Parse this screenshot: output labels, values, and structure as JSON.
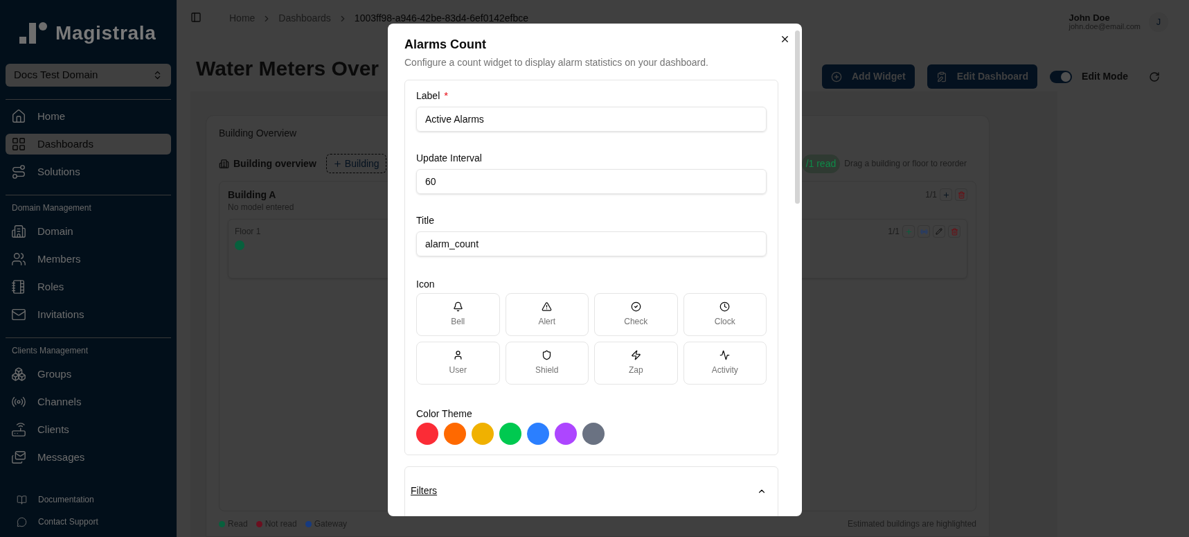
{
  "sidebar": {
    "logo": "Magistrala",
    "domain_select": "Docs Test Domain",
    "sections": [
      {
        "items": [
          {
            "label": "Home",
            "selected": false
          },
          {
            "label": "Dashboards",
            "selected": true
          },
          {
            "label": "Solutions",
            "selected": false
          }
        ]
      },
      {
        "heading": "Domain Management",
        "items": [
          {
            "label": "Domain",
            "selected": false
          },
          {
            "label": "Members",
            "selected": false
          },
          {
            "label": "Roles",
            "selected": false
          },
          {
            "label": "Invitations",
            "selected": false
          }
        ]
      },
      {
        "heading": "Clients Management",
        "items": [
          {
            "label": "Groups",
            "selected": false
          },
          {
            "label": "Channels",
            "selected": false
          },
          {
            "label": "Clients",
            "selected": false
          },
          {
            "label": "Messages",
            "selected": false
          }
        ]
      }
    ],
    "footer_links": [
      "Documentation",
      "Contact Support"
    ]
  },
  "header": {
    "breadcrumbs": [
      "Home",
      "Dashboards",
      "1003ff98-a946-42be-83d4-6ef0142efbce"
    ],
    "user": {
      "name": "John Doe",
      "email": "john.doe@email.com",
      "avatar": "J"
    }
  },
  "page": {
    "title": "Water Meters Over",
    "actions": [
      "Add Widget",
      "Edit Dashboard"
    ],
    "edit_mode": {
      "label": "Edit Mode",
      "on": true
    }
  },
  "widget": {
    "title": "Building Overview",
    "subtitle": "Building overview",
    "add_button": "Building",
    "read_badge": "/1 read",
    "hint": "Drag a building or floor to reorder",
    "buildings": [
      {
        "name": "Building A",
        "model": "No model entered",
        "count": "1/1",
        "floors": [
          {
            "name": "Floor 1",
            "count": "1/1",
            "meters": [
              {
                "color": "#07603d"
              }
            ]
          }
        ]
      }
    ],
    "legend": [
      {
        "label": "Read",
        "color": "#07603d"
      },
      {
        "label": "Not read",
        "color": "#6b0f1f"
      },
      {
        "label": "Gateway",
        "color": "#163a80"
      }
    ],
    "footnote": "Estimated buildings are highlighted"
  },
  "dialog": {
    "title": "Alarms Count",
    "description": "Configure a count widget to display alarm statistics on your dashboard.",
    "required_marker": "*",
    "fields": [
      {
        "label": "Label",
        "required": true,
        "value": "Active Alarms"
      },
      {
        "label": "Update Interval",
        "required": false,
        "value": "60"
      },
      {
        "label": "Title",
        "required": false,
        "value": "alarm_count"
      }
    ],
    "icon_label": "Icon",
    "icon_options": [
      "Bell",
      "Alert",
      "Check",
      "Clock",
      "User",
      "Shield",
      "Zap",
      "Activity"
    ],
    "color_label": "Color Theme",
    "colors": [
      {
        "color": "#fb2c36"
      },
      {
        "color": "#ff6900"
      },
      {
        "color": "#f0b100"
      },
      {
        "color": "#00c950"
      },
      {
        "color": "#2b7fff"
      },
      {
        "color": "#ad46ff"
      },
      {
        "color": "#6a7282"
      }
    ],
    "filters": {
      "label": "Filters",
      "expanded": true
    }
  }
}
